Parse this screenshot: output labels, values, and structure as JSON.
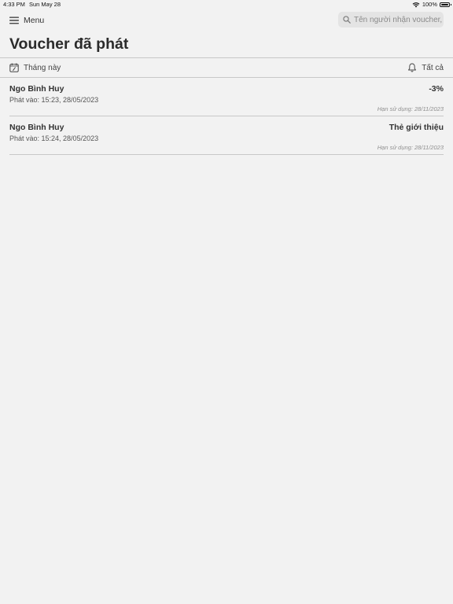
{
  "status_bar": {
    "time": "4:33 PM",
    "date": "Sun May 28",
    "battery": "100%",
    "battery_level": 1.0,
    "wifi_icon": "wifi-icon"
  },
  "nav": {
    "menu_label": "Menu",
    "menu_icon": "hamburger-icon",
    "search_placeholder": "Tên người nhận voucher,...",
    "search_value": "",
    "search_icon": "search-icon"
  },
  "page": {
    "title": "Voucher đã phát"
  },
  "filters": {
    "period_label": "Tháng này",
    "period_icon": "calendar-icon",
    "type_label": "Tất cả",
    "type_icon": "bell-icon"
  },
  "vouchers": [
    {
      "recipient": "Ngo Bình Huy",
      "issued": "Phát vào: 15:23, 28/05/2023",
      "value": "-3%",
      "expiry": "Hạn sử dụng: 28/11/2023"
    },
    {
      "recipient": "Ngo Bình Huy",
      "issued": "Phát vào: 15:24, 28/05/2023",
      "value": "Thẻ giới thiệu",
      "expiry": "Hạn sử dụng: 28/11/2023"
    }
  ]
}
